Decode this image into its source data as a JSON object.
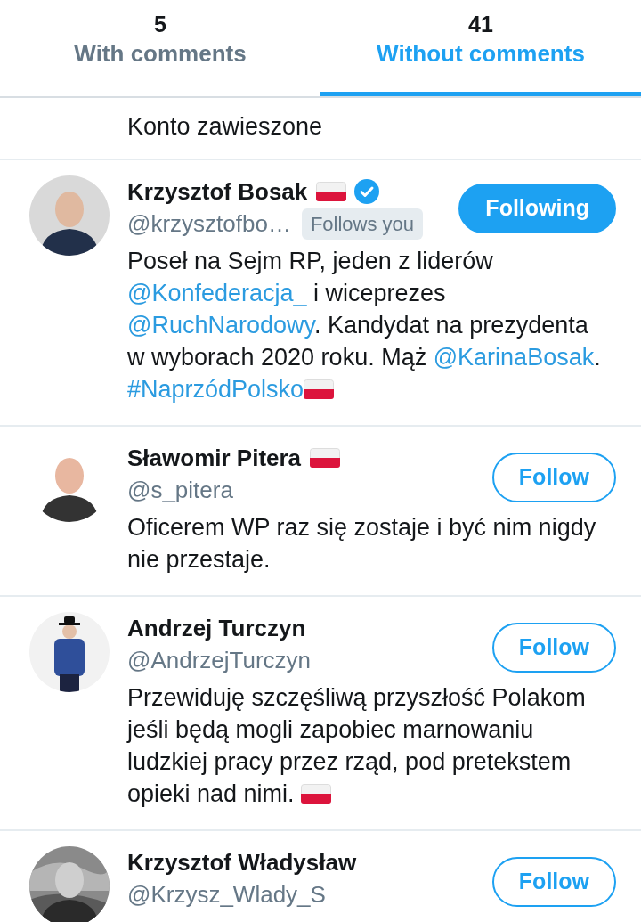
{
  "tabs": [
    {
      "count": "5",
      "label": "With comments",
      "selected": false
    },
    {
      "count": "41",
      "label": "Without comments",
      "selected": true
    }
  ],
  "partial_row": {
    "text": "Konto zawieszone"
  },
  "users": [
    {
      "name": "Krzysztof Bosak",
      "flag": true,
      "verified": true,
      "handle": "@krzysztofbo…",
      "follows_you": "Follows you",
      "button": "Following",
      "following": true,
      "bio": [
        {
          "kind": "text",
          "text": "Poseł na Sejm RP, jeden z liderów "
        },
        {
          "kind": "link",
          "text": "@Konfederacja_"
        },
        {
          "kind": "text",
          "text": " i wiceprezes "
        },
        {
          "kind": "link",
          "text": "@RuchNarodowy"
        },
        {
          "kind": "text",
          "text": ". Kandydat na prezydenta w wyborach 2020 roku. Mąż "
        },
        {
          "kind": "link",
          "text": "@KarinaBosak"
        },
        {
          "kind": "text",
          "text": ". "
        },
        {
          "kind": "link",
          "text": "#NaprzódPolsko"
        },
        {
          "kind": "flag"
        }
      ]
    },
    {
      "name": "Sławomir Pitera",
      "flag": true,
      "verified": false,
      "handle": "@s_pitera",
      "button": "Follow",
      "following": false,
      "bio": [
        {
          "kind": "text",
          "text": "Oficerem WP raz się zostaje i być nim nigdy nie przestaje."
        }
      ]
    },
    {
      "name": "Andrzej Turczyn",
      "flag": false,
      "verified": false,
      "handle": "@AndrzejTurczyn",
      "button": "Follow",
      "following": false,
      "bio": [
        {
          "kind": "text",
          "text": "Przewiduję szczęśliwą przyszłość Polakom jeśli będą mogli zapobiec marnowaniu ludzkiej pracy przez rząd, pod pretekstem opieki nad nimi. "
        },
        {
          "kind": "flag"
        }
      ]
    },
    {
      "name": "Krzysztof Władysław",
      "flag": false,
      "verified": false,
      "handle": "@Krzysz_Wlady_S",
      "button": "Follow",
      "following": false
    }
  ]
}
